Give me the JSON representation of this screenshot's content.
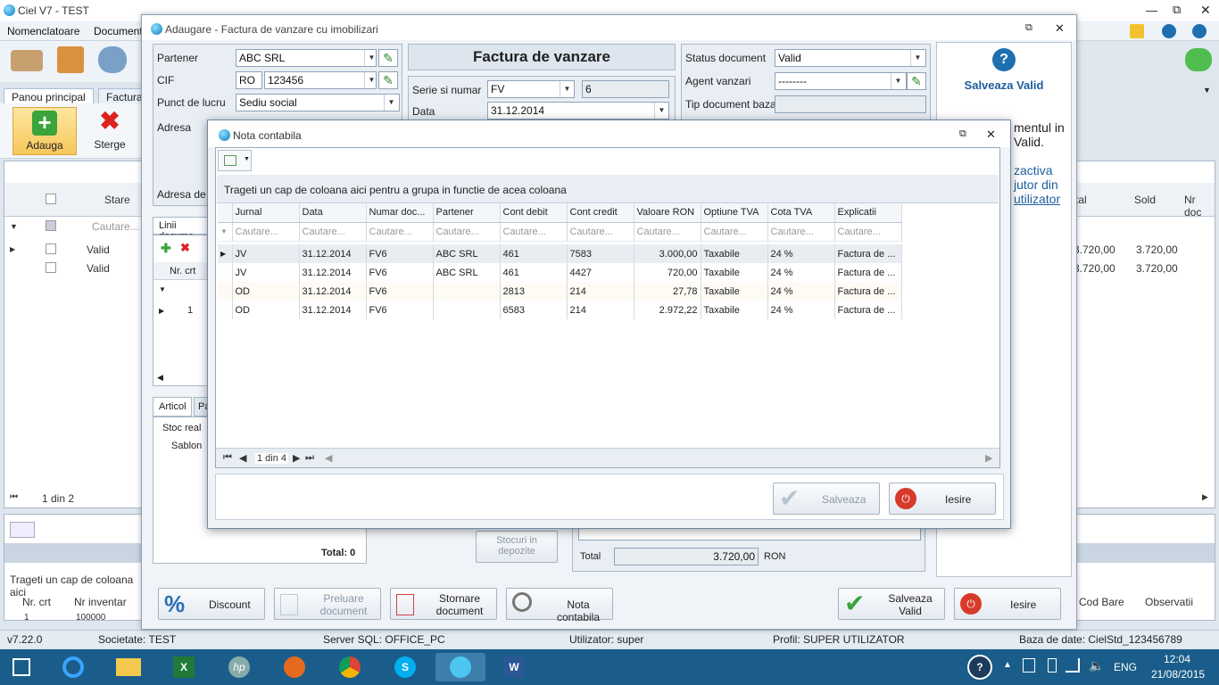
{
  "app": {
    "title": "Ciel V7 - TEST",
    "menu": [
      "Nomenclatoare",
      "Documente"
    ],
    "ribbon_tabs": [
      "Panou principal",
      "Factura"
    ],
    "ribbon_buttons": {
      "add": "Adauga",
      "delete": "Sterge"
    },
    "grid": {
      "header_state": "Stare",
      "filter_placeholder": "Cautare...",
      "rows": [
        {
          "state": "Valid"
        },
        {
          "state": "Valid"
        }
      ],
      "pager": "1 din 2",
      "right_headers": [
        "tal",
        "Sold",
        "Nr doc"
      ],
      "right_rows": [
        [
          "3.720,00",
          "3.720,00"
        ],
        [
          "3.720,00",
          "3.720,00"
        ]
      ]
    },
    "bottom_grid": {
      "group_hint": "Trageti un cap de coloana aici",
      "headers": [
        "Nr. crt",
        "Nr inventar"
      ],
      "row": [
        "1",
        "100000"
      ],
      "right_headers": [
        "Cod Bare",
        "Observatii"
      ]
    },
    "status": {
      "version": "v7.22.0",
      "company": "Societate: TEST",
      "server": "Server SQL: OFFICE_PC",
      "user": "Utilizator: super",
      "profile": "Profil: SUPER UTILIZATOR",
      "database": "Baza de date: CielStd_123456789"
    },
    "taskbar": {
      "lang": "ENG",
      "time": "12:04",
      "date": "21/08/2015"
    }
  },
  "invoice": {
    "title": "Adaugare - Factura de vanzare cu imobilizari",
    "doc_title": "Factura de vanzare",
    "partner_label": "Partener",
    "partner_value": "ABC SRL",
    "cif_label": "CIF",
    "cif_prefix": "RO",
    "cif_value": "123456",
    "workpoint_label": "Punct de lucru",
    "workpoint_value": "Sediu social",
    "address_label": "Adresa",
    "delivery_label": "Adresa de li",
    "series_label": "Serie si numar",
    "series_value": "FV",
    "number_value": "6",
    "date_label": "Data",
    "date_value": "31.12.2014",
    "status_label": "Status document",
    "status_value": "Valid",
    "agent_label": "Agent vanzari",
    "agent_value": "--------",
    "basedoc_label": "Tip document baza",
    "lines_tab": "Linii docume",
    "lines_header": "Nr. crt",
    "lines_row": "1",
    "article_tabs": [
      "Articol",
      "Pa"
    ],
    "stock_label": "Stoc real",
    "template_label": "Sablon",
    "total_items": "Total: 0",
    "stocks_btn": "Stocuri in depozite",
    "total_label": "Total",
    "total_value": "3.720,00",
    "currency": "RON",
    "help": {
      "title": "Salveaza Valid",
      "text1": "mentul in",
      "text2": "Valid.",
      "text3": "zactiva",
      "text4": "jutor din",
      "link": "utilizator"
    },
    "buttons": {
      "discount": "Discount",
      "take_doc": "Preluare document",
      "reverse_doc": "Stornare document",
      "nota": "Nota contabila",
      "save_valid": "Salveaza Valid",
      "exit": "Iesire"
    }
  },
  "nota": {
    "title": "Nota contabila",
    "group_hint": "Trageti un cap de coloana aici pentru a grupa in functie de acea coloana",
    "columns": [
      "Jurnal",
      "Data",
      "Numar doc...",
      "Partener",
      "Cont debit",
      "Cont credit",
      "Valoare RON",
      "Optiune TVA",
      "Cota TVA",
      "Explicatii"
    ],
    "filter_placeholder": "Cautare...",
    "rows": [
      [
        "JV",
        "31.12.2014",
        "FV6",
        "ABC SRL",
        "461",
        "7583",
        "3.000,00",
        "Taxabile",
        "24 %",
        "Factura de ..."
      ],
      [
        "JV",
        "31.12.2014",
        "FV6",
        "ABC SRL",
        "461",
        "4427",
        "720,00",
        "Taxabile",
        "24 %",
        "Factura de ..."
      ],
      [
        "OD",
        "31.12.2014",
        "FV6",
        "",
        "2813",
        "214",
        "27,78",
        "Taxabile",
        "24 %",
        "Factura de ..."
      ],
      [
        "OD",
        "31.12.2014",
        "FV6",
        "",
        "6583",
        "214",
        "2.972,22",
        "Taxabile",
        "24 %",
        "Factura de ..."
      ]
    ],
    "pager": "1 din 4",
    "save_label": "Salveaza",
    "exit_label": "Iesire"
  }
}
